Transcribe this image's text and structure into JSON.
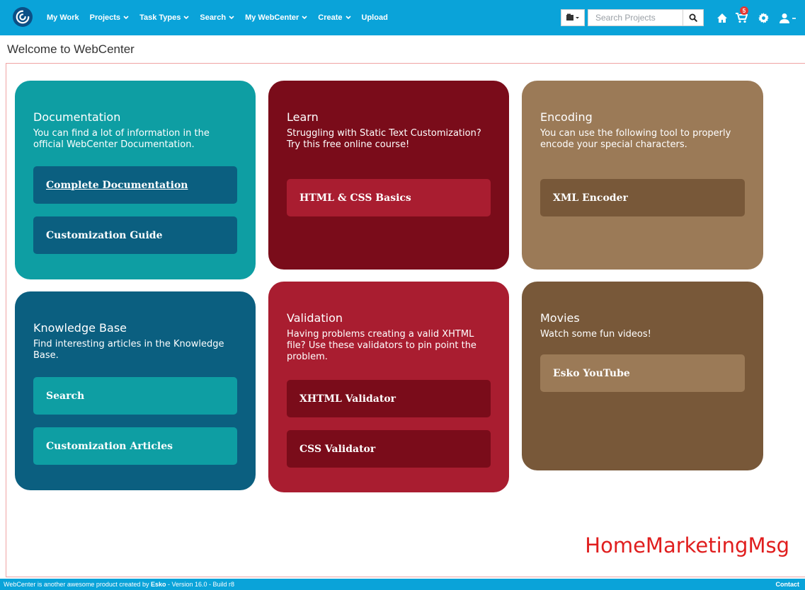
{
  "nav": {
    "items": [
      {
        "label": "My Work",
        "dropdown": false
      },
      {
        "label": "Projects",
        "dropdown": true
      },
      {
        "label": "Task Types",
        "dropdown": true
      },
      {
        "label": "Search",
        "dropdown": true
      },
      {
        "label": "My WebCenter",
        "dropdown": true
      },
      {
        "label": "Create",
        "dropdown": true
      },
      {
        "label": "Upload",
        "dropdown": false
      }
    ],
    "search_placeholder": "Search Projects",
    "cart_count": "5",
    "icons": [
      "webcenter-logo-icon",
      "projects-type-icon",
      "search-icon",
      "home-icon",
      "cart-icon",
      "gear-icon",
      "user-icon"
    ]
  },
  "page_title": "Welcome to WebCenter",
  "cards": {
    "documentation": {
      "title": "Documentation",
      "text": "You can find a lot of information in the official WebCenter Documentation.",
      "buttons": [
        "Complete Documentation",
        "Customization Guide"
      ]
    },
    "learn": {
      "title": "Learn",
      "text": "Struggling with Static Text Customization? Try this free online course!",
      "buttons": [
        "HTML & CSS Basics"
      ]
    },
    "encoding": {
      "title": "Encoding",
      "text": "You can use the following tool to properly encode your special characters.",
      "buttons": [
        "XML Encoder"
      ]
    },
    "knowledge": {
      "title": "Knowledge Base",
      "text": "Find interesting articles in the Knowledge Base.",
      "buttons": [
        "Search",
        "Customization Articles"
      ]
    },
    "validation": {
      "title": "Validation",
      "text": "Having problems creating a valid XHTML file? Use these validators to pin point the problem.",
      "buttons": [
        "XHTML Validator",
        "CSS Validator"
      ]
    },
    "movies": {
      "title": "Movies",
      "text": "Watch some fun videos!",
      "buttons": [
        "Esko YouTube"
      ]
    }
  },
  "marketing_msg": "HomeMarketingMsg",
  "footer": {
    "prefix": "WebCenter is another awesome product created by",
    "brand": "Esko",
    "version": "- Version 16.0 - Build r8",
    "contact": "Contact"
  },
  "colors": {
    "nav_bg": "#0aa3d9",
    "teal": "#0e9ea3",
    "dark_blue": "#0b5f80",
    "maroon": "#7a0c1a",
    "red": "#a91d30",
    "tan": "#9b7a57",
    "brown": "#785839",
    "marketing_red": "#e01e1e"
  }
}
